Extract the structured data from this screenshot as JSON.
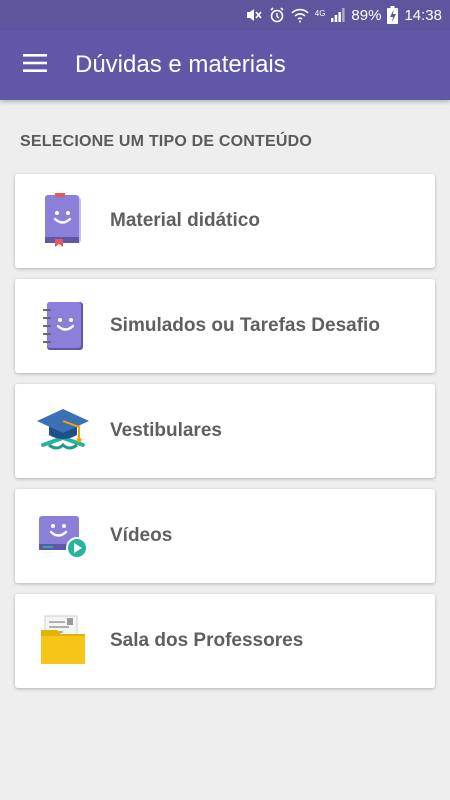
{
  "status_bar": {
    "battery": "89%",
    "network": "4G",
    "time": "14:38",
    "icons": [
      "mute-icon",
      "alarm-icon",
      "wifi-icon",
      "signal-icon",
      "battery-charging-icon"
    ]
  },
  "app_bar": {
    "title": "Dúvidas e materiais",
    "menu_icon": "hamburger-menu-icon"
  },
  "content": {
    "section_label": "SELECIONE UM TIPO DE CONTEÚDO",
    "items": [
      {
        "label": "Material didático",
        "icon": "book-icon"
      },
      {
        "label": "Simulados ou Tarefas Desafio",
        "icon": "notebook-icon"
      },
      {
        "label": "Vestibulares",
        "icon": "graduation-cap-icon"
      },
      {
        "label": "Vídeos",
        "icon": "video-icon"
      },
      {
        "label": "Sala dos Professores",
        "icon": "folder-icon"
      }
    ]
  },
  "colors": {
    "primary": "#5f58a8",
    "icon_purple": "#8a7fd9",
    "accent_green": "#26b4a0",
    "background": "#eeeeee"
  }
}
